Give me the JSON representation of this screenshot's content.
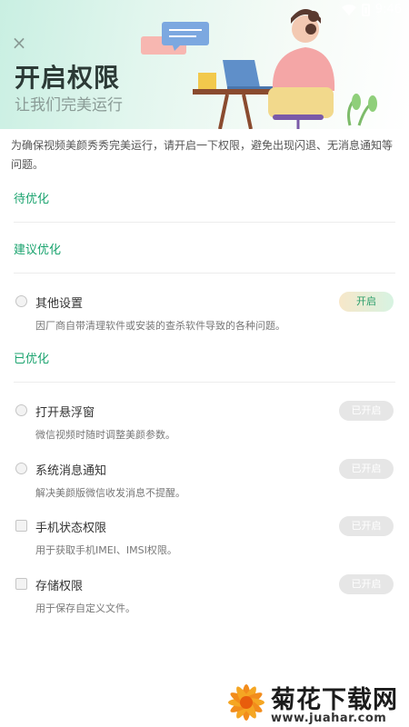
{
  "status_bar": {
    "time": "9:46"
  },
  "header": {
    "title": "开启权限",
    "subtitle": "让我们完美运行"
  },
  "intro": "为确保视频美颜秀秀完美运行，请开启一下权限，避免出现闪退、无消息通知等问题。",
  "sections": {
    "pending": "待优化",
    "suggested": "建议优化",
    "optimized": "已优化"
  },
  "suggested_items": [
    {
      "name": "其他设置",
      "desc": "因厂商自带清理软件或安装的查杀软件导致的各种问题。",
      "button": "开启"
    }
  ],
  "optimized_items": [
    {
      "name": "打开悬浮窗",
      "desc": "微信视频时随时调整美颜参数。",
      "button": "已开启"
    },
    {
      "name": "系统消息通知",
      "desc": "解决美颜版微信收发消息不提醒。",
      "button": "已开启"
    },
    {
      "name": "手机状态权限",
      "desc": "用于获取手机IMEI、IMSI权限。",
      "button": "已开启"
    },
    {
      "name": "存储权限",
      "desc": "用于保存自定义文件。",
      "button": "已开启"
    }
  ],
  "colors": {
    "accent": "#1aa36e",
    "banner": "#c9efe2",
    "disabled": "#e6e6e6"
  },
  "watermark": {
    "title": "菊花下载网",
    "url": "www.juahar.com"
  }
}
